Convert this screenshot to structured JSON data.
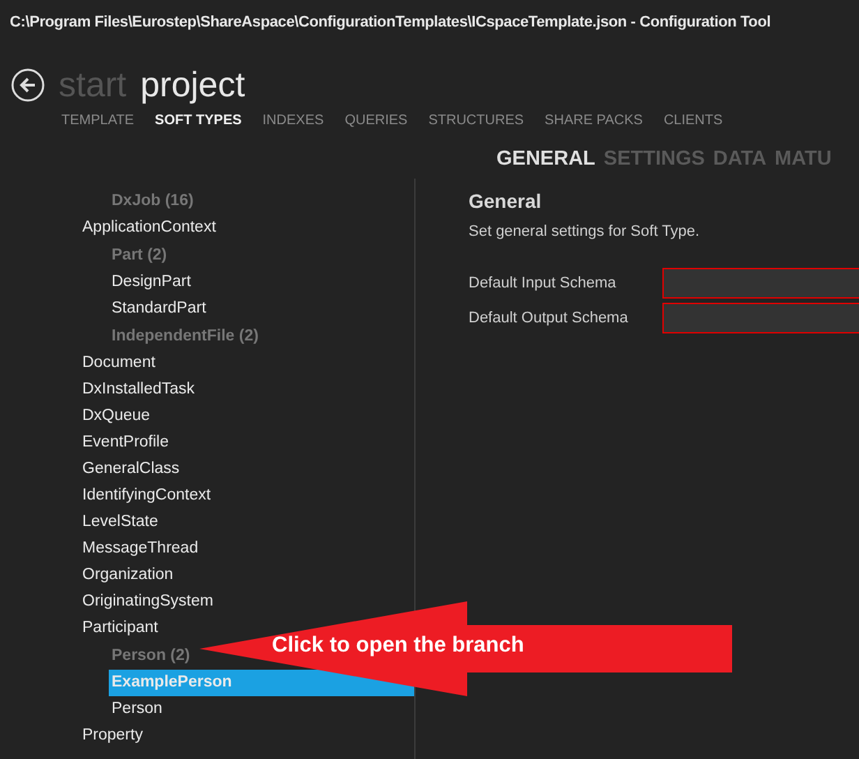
{
  "window": {
    "title": "C:\\Program Files\\Eurostep\\ShareAspace\\ConfigurationTemplates\\ICspaceTemplate.json - Configuration Tool"
  },
  "breadcrumb": [
    {
      "label": "start",
      "selected": false
    },
    {
      "label": "project",
      "selected": true
    }
  ],
  "tabs": [
    {
      "label": "TEMPLATE",
      "selected": false
    },
    {
      "label": "SOFT TYPES",
      "selected": true
    },
    {
      "label": "INDEXES",
      "selected": false
    },
    {
      "label": "QUERIES",
      "selected": false
    },
    {
      "label": "STRUCTURES",
      "selected": false
    },
    {
      "label": "SHARE PACKS",
      "selected": false
    },
    {
      "label": "CLIENTS",
      "selected": false
    }
  ],
  "tree": [
    {
      "kind": "group",
      "label": "DxJob (16)"
    },
    {
      "kind": "item",
      "label": "ApplicationContext",
      "selected": false
    },
    {
      "kind": "group",
      "label": "Part (2)",
      "children": [
        {
          "kind": "item",
          "label": "DesignPart",
          "selected": false
        },
        {
          "kind": "item",
          "label": "StandardPart",
          "selected": false
        }
      ]
    },
    {
      "kind": "group",
      "label": "IndependentFile (2)"
    },
    {
      "kind": "item",
      "label": "Document",
      "selected": false
    },
    {
      "kind": "item",
      "label": "DxInstalledTask",
      "selected": false
    },
    {
      "kind": "item",
      "label": "DxQueue",
      "selected": false
    },
    {
      "kind": "item",
      "label": "EventProfile",
      "selected": false
    },
    {
      "kind": "item",
      "label": "GeneralClass",
      "selected": false
    },
    {
      "kind": "item",
      "label": "IdentifyingContext",
      "selected": false
    },
    {
      "kind": "item",
      "label": "LevelState",
      "selected": false
    },
    {
      "kind": "item",
      "label": "MessageThread",
      "selected": false
    },
    {
      "kind": "item",
      "label": "Organization",
      "selected": false
    },
    {
      "kind": "item",
      "label": "OriginatingSystem",
      "selected": false
    },
    {
      "kind": "item",
      "label": "Participant",
      "selected": false
    },
    {
      "kind": "group",
      "label": "Person (2)",
      "children": [
        {
          "kind": "item",
          "label": "ExamplePerson",
          "selected": true
        },
        {
          "kind": "item",
          "label": "Person",
          "selected": false
        }
      ]
    },
    {
      "kind": "item",
      "label": "Property",
      "selected": false
    }
  ],
  "detail_tabs": [
    {
      "label": "GENERAL",
      "selected": true
    },
    {
      "label": "SETTINGS",
      "selected": false
    },
    {
      "label": "DATA",
      "selected": false
    },
    {
      "label": "MATU",
      "selected": false
    }
  ],
  "section": {
    "title": "General",
    "description": "Set general settings for Soft Type."
  },
  "fields": [
    {
      "label": "Default Input Schema",
      "invalid": true
    },
    {
      "label": "Default Output Schema",
      "invalid": true
    }
  ],
  "annotation": {
    "text": "Click to open the branch"
  }
}
